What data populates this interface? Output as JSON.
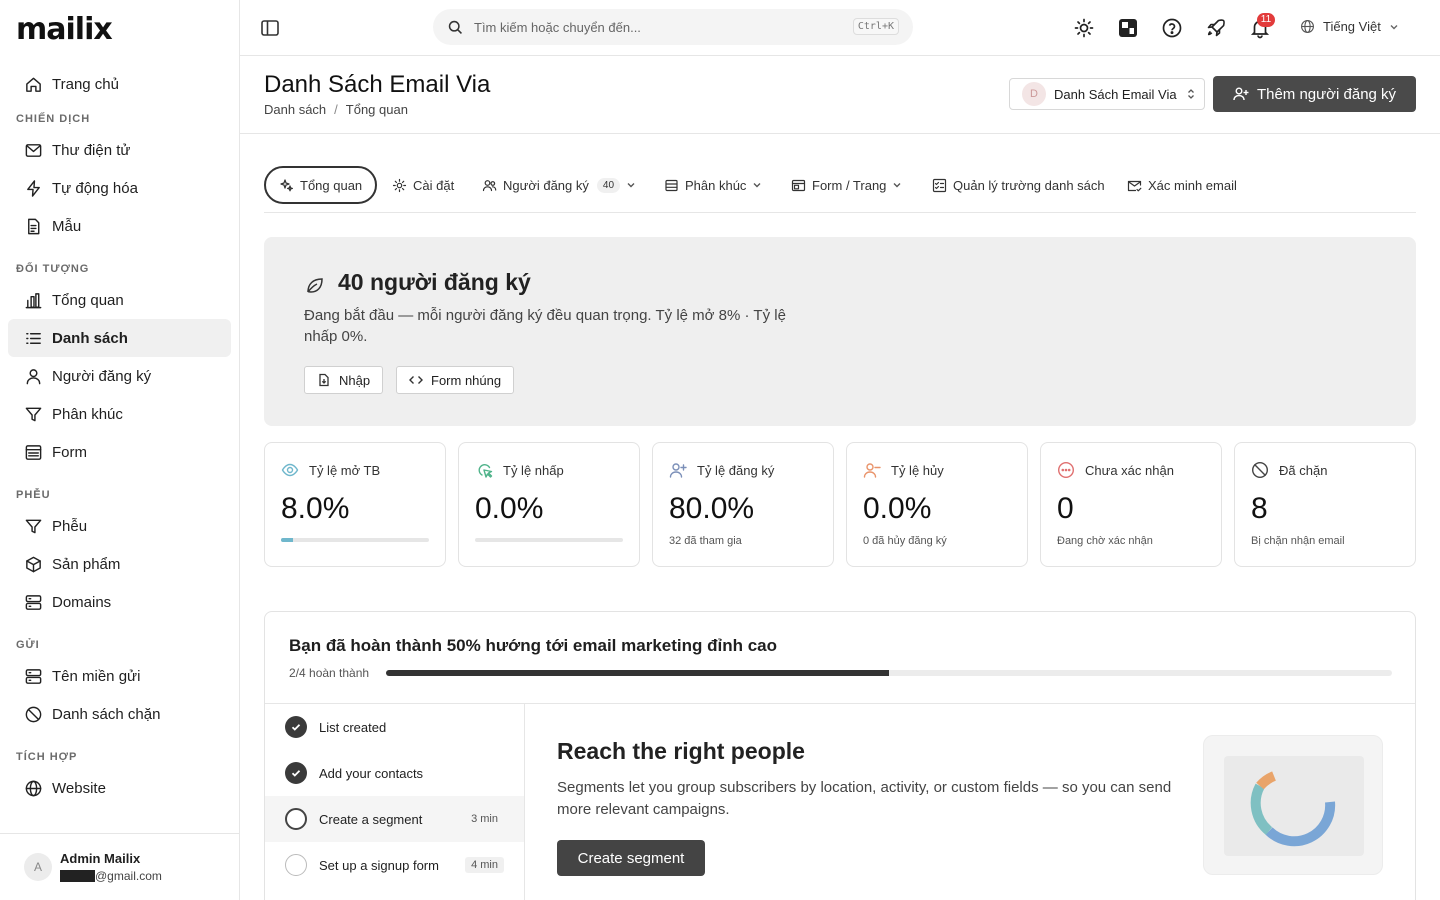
{
  "app": {
    "logo": "mailix"
  },
  "sidebar": {
    "items": [
      {
        "label": "Trang chủ",
        "icon": "home-icon"
      },
      {
        "section": "CHIẾN DỊCH"
      },
      {
        "label": "Thư điện tử",
        "icon": "mail-icon"
      },
      {
        "label": "Tự động hóa",
        "icon": "zap-icon"
      },
      {
        "label": "Mẫu",
        "icon": "file-text-icon"
      },
      {
        "section": "ĐỐI TƯỢNG"
      },
      {
        "label": "Tổng quan",
        "icon": "bar-chart-icon"
      },
      {
        "label": "Danh sách",
        "icon": "list-icon",
        "active": true
      },
      {
        "label": "Người đăng ký",
        "icon": "user-icon"
      },
      {
        "label": "Phân khúc",
        "icon": "filter-icon"
      },
      {
        "label": "Form",
        "icon": "form-icon"
      },
      {
        "section": "PHỄU"
      },
      {
        "label": "Phễu",
        "icon": "funnel-icon"
      },
      {
        "label": "Sản phẩm",
        "icon": "package-icon"
      },
      {
        "label": "Domains",
        "icon": "server-icon"
      },
      {
        "section": "GỬI"
      },
      {
        "label": "Tên miền gửi",
        "icon": "server-icon"
      },
      {
        "label": "Danh sách chặn",
        "icon": "ban-icon"
      },
      {
        "section": "TÍCH HỢP"
      },
      {
        "label": "Website",
        "icon": "globe-icon"
      }
    ],
    "user": {
      "initial": "A",
      "name": "Admin Mailix",
      "email_suffix": "@gmail.com"
    }
  },
  "topbar": {
    "search_placeholder": "Tìm kiếm hoặc chuyển đến...",
    "search_shortcut": "Ctrl+K",
    "notification_count": "11",
    "language": "Tiếng Việt"
  },
  "header": {
    "title": "Danh Sách Email Via",
    "breadcrumb": [
      "Danh sách",
      "Tổng quan"
    ],
    "breadcrumb_sep": "/",
    "list_select": {
      "initial": "D",
      "label": "Danh Sách Email Via"
    },
    "add_button": "Thêm người đăng ký"
  },
  "tabs": [
    {
      "label": "Tổng quan",
      "icon": "sparkles-icon",
      "active": true
    },
    {
      "label": "Cài đặt",
      "icon": "gear-icon"
    },
    {
      "label": "Người đăng ký",
      "icon": "users-icon",
      "count": "40",
      "dropdown": true
    },
    {
      "label": "Phân khúc",
      "icon": "layers-icon",
      "dropdown": true
    },
    {
      "label": "Form / Trang",
      "icon": "window-icon",
      "dropdown": true
    },
    {
      "label": "Quản lý trường danh sách",
      "icon": "checklist-icon"
    },
    {
      "label": "Xác minh email",
      "icon": "mail-check-icon"
    }
  ],
  "hero": {
    "title": "40 người đăng ký",
    "subtitle": "Đang bắt đầu — mỗi người đăng ký đều quan trọng. Tỷ lệ mở 8% · Tỷ lệ nhấp 0%.",
    "import_button": "Nhập",
    "embed_button": "Form nhúng"
  },
  "stats": [
    {
      "label": "Tỷ lệ mở TB",
      "value": "8.0%",
      "progress": 0.08,
      "icon": "eye-icon",
      "color": "#6fb7cc"
    },
    {
      "label": "Tỷ lệ nhấp",
      "value": "0.0%",
      "progress": 0.0,
      "icon": "click-icon",
      "color": "#4fb38a"
    },
    {
      "label": "Tỷ lệ đăng ký",
      "value": "80.0%",
      "sub": "32 đã tham gia",
      "icon": "user-plus-icon",
      "color": "#7b8fb8"
    },
    {
      "label": "Tỷ lệ hủy",
      "value": "0.0%",
      "sub": "0 đã hủy đăng ký",
      "icon": "user-minus-icon",
      "color": "#e9936a"
    },
    {
      "label": "Chưa xác nhận",
      "value": "0",
      "sub": "Đang chờ xác nhận",
      "icon": "pending-icon",
      "color": "#e07070"
    },
    {
      "label": "Đã chặn",
      "value": "8",
      "sub": "Bị chặn nhận email",
      "icon": "ban-icon",
      "color": "#444444"
    }
  ],
  "onboarding": {
    "title": "Bạn đã hoàn thành 50% hướng tới email marketing đỉnh cao",
    "progress_label": "2/4 hoàn thành",
    "progress": 0.5,
    "steps": [
      {
        "label": "List created",
        "done": true
      },
      {
        "label": "Add your contacts",
        "done": true
      },
      {
        "label": "Create a segment",
        "time": "3 min",
        "active": true
      },
      {
        "label": "Set up a signup form",
        "time": "4 min"
      }
    ],
    "content_title": "Reach the right people",
    "content_desc": "Segments let you group subscribers by location, activity, or custom fields — so you can send more relevant campaigns.",
    "cta": "Create segment"
  }
}
